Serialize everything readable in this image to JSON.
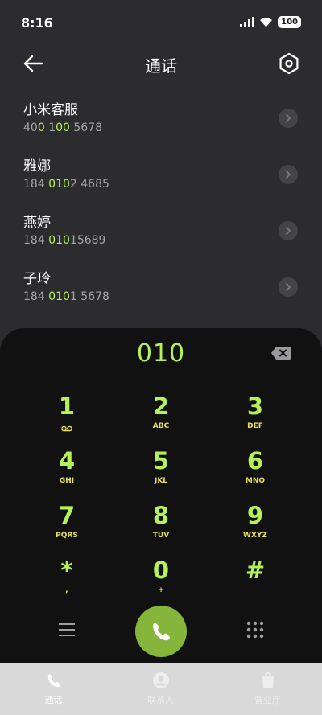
{
  "status_bar": {
    "time": "8:16",
    "battery": "100"
  },
  "header": {
    "title": "通话"
  },
  "results": [
    {
      "name": "小米客服",
      "number_parts": [
        "40",
        "0",
        " 1",
        "00",
        " 5678"
      ]
    },
    {
      "name": "雅娜",
      "number_parts": [
        "184 ",
        "010",
        "2 4685",
        "",
        ""
      ]
    },
    {
      "name": "燕婷",
      "number_parts": [
        "184 ",
        "010",
        "15689",
        "",
        ""
      ]
    },
    {
      "name": "子玲",
      "number_parts": [
        "184 ",
        "010",
        "1 5678",
        "",
        ""
      ]
    }
  ],
  "dialpad": {
    "display": "010",
    "keys": [
      {
        "digit": "1",
        "letters": ""
      },
      {
        "digit": "2",
        "letters": "ABC"
      },
      {
        "digit": "3",
        "letters": "DEF"
      },
      {
        "digit": "4",
        "letters": "GHI"
      },
      {
        "digit": "5",
        "letters": "JKL"
      },
      {
        "digit": "6",
        "letters": "MNO"
      },
      {
        "digit": "7",
        "letters": "PQRS"
      },
      {
        "digit": "8",
        "letters": "TUV"
      },
      {
        "digit": "9",
        "letters": "WXYZ"
      },
      {
        "digit": "*",
        "letters": ","
      },
      {
        "digit": "0",
        "letters": "+"
      },
      {
        "digit": "#",
        "letters": ""
      }
    ]
  },
  "bottom_nav": {
    "items": [
      {
        "label": "通话",
        "icon": "phone-icon"
      },
      {
        "label": "联系人",
        "icon": "contacts-icon"
      },
      {
        "label": "营业厅",
        "icon": "store-icon"
      }
    ]
  },
  "colors": {
    "accent": "#b6f05a",
    "letters": "#e8e05a",
    "call": "#86b53c"
  }
}
